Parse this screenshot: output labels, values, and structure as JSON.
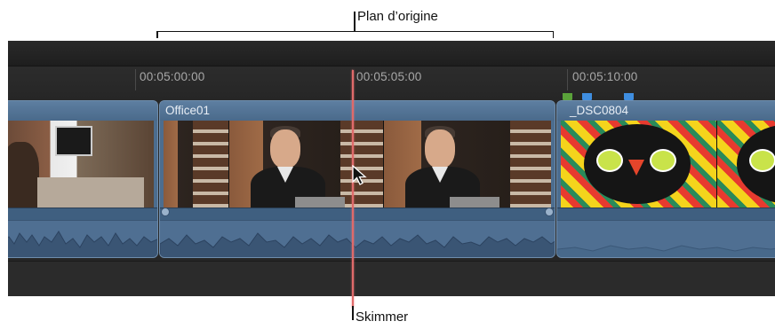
{
  "callouts": {
    "top_label": "Plan d’origine",
    "bottom_label": "Skimmer"
  },
  "ruler": {
    "timecodes": [
      "00:05:00:00",
      "00:05:05:00",
      "00:05:10:00"
    ]
  },
  "clips": [
    {
      "name": ""
    },
    {
      "name": "Office01"
    },
    {
      "name": "_DSC0804"
    }
  ],
  "colors": {
    "clip_blue": "#4c6d8f",
    "skimmer": "#e06a6a",
    "marker_green": "#5aa23a",
    "marker_blue": "#3f8ee0"
  },
  "icons": {
    "cursor": "arrow-pointer-icon",
    "marker": "marker-icon"
  }
}
